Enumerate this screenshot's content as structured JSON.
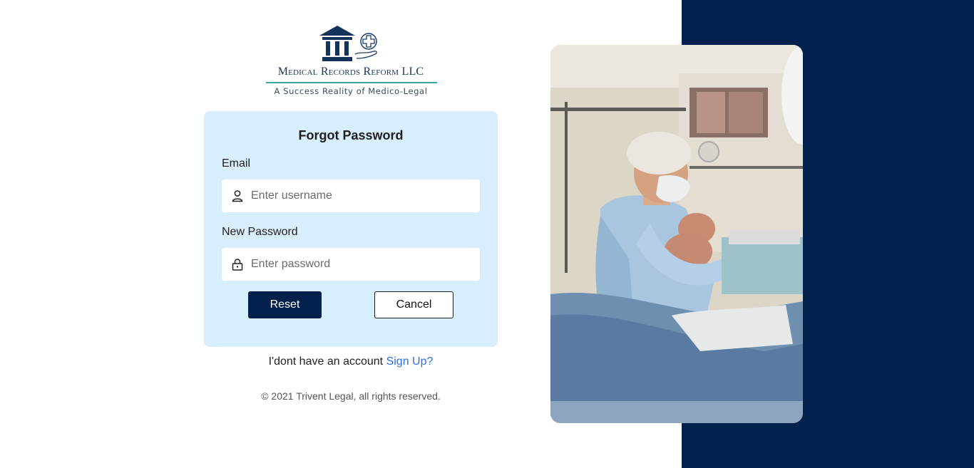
{
  "brand": {
    "name": "Medical Records Reform LLC",
    "tagline": "A Success Reality of Medico-Legal",
    "navy": "#04214d",
    "teal_rule": "#3aa6a2"
  },
  "form": {
    "title": "Forgot Password",
    "email": {
      "label": "Email",
      "placeholder": "Enter username",
      "value": "",
      "icon": "user-icon"
    },
    "password": {
      "label": "New Password",
      "placeholder": "Enter password",
      "value": "",
      "icon": "lock-icon"
    },
    "reset_label": "Reset",
    "cancel_label": "Cancel"
  },
  "signup": {
    "prompt": "I'dont have an account",
    "link_label": "Sign Up?"
  },
  "footer": {
    "copyright": "© 2021 Trivent Legal, all rights reserved."
  },
  "colors": {
    "card_bg": "#d8eefc",
    "link": "#2c6fdc",
    "right_panel": "#04214d"
  },
  "hero_image": {
    "icon": "hero-photo"
  }
}
